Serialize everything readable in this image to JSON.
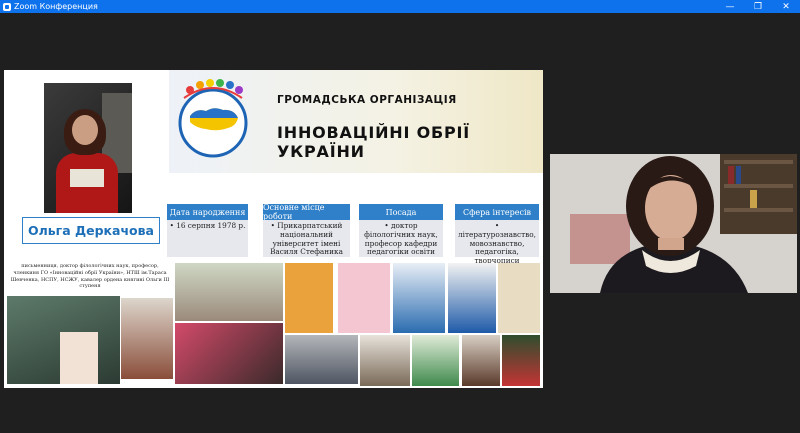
{
  "window": {
    "title": "Zoom Конференция",
    "controls": {
      "minimize": "—",
      "maximize": "❐",
      "close": "✕"
    }
  },
  "slide": {
    "org_line1": "ГРОМАДСЬКА ОРГАНІЗАЦІЯ",
    "org_line2": "ІННОВАЦІЙНІ ОБРІЇ УКРАЇНИ",
    "person_name": "Ольга Деркачова",
    "columns": [
      {
        "header": "Дата народження",
        "body": "• 16 серпня 1978 р."
      },
      {
        "header": "Основне місце роботи",
        "body": "• Прикарпатський національний університет імені Василя Стефаника"
      },
      {
        "header": "Посада",
        "body": "• доктор філологічних наук, професор кафедри педагогіки освіти"
      },
      {
        "header": "Сфера інтересів",
        "body": "• літературознавство, мовознавство, педагогіка, творчопиcи"
      }
    ],
    "bio": "письменниця, доктор філологічних наук, професор, членкиня ГО «Інноваційні обрії України», НТШ ім.Тараса Шевченка, НСПУ, НСЖУ, кавалер ордена княгині Ольги ІІІ ступеня"
  },
  "colors": {
    "zoom_blue": "#0e72ed",
    "slide_blue": "#2f80c9",
    "background": "#1f1f1f"
  },
  "icons": [
    "zoom-app-icon",
    "minimize-icon",
    "maximize-icon",
    "close-icon"
  ]
}
